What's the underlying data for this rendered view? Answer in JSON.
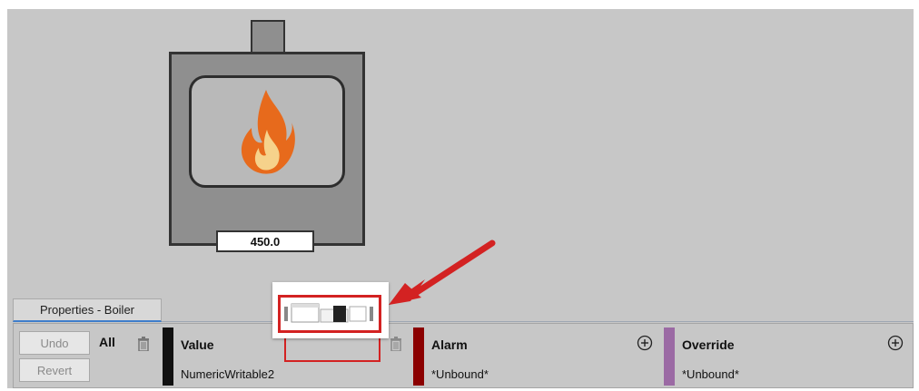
{
  "boiler": {
    "display_value": "450.0"
  },
  "properties": {
    "tab_label": "Properties - Boiler",
    "buttons": {
      "undo": "Undo",
      "revert": "Revert"
    },
    "all_label": "All",
    "slots": [
      {
        "title": "Value",
        "binding": "NumericWritable2",
        "color": "#111111"
      },
      {
        "title": "Alarm",
        "binding": "*Unbound*",
        "color": "#8b0000"
      },
      {
        "title": "Override",
        "binding": "*Unbound*",
        "color": "#9b6aa4"
      }
    ]
  },
  "colors": {
    "canvas": "#c7c7c7",
    "flame_outer": "#e76a1c",
    "flame_inner": "#f6d28b",
    "callout": "#d32222",
    "tab_underline": "#3f7ecb"
  }
}
